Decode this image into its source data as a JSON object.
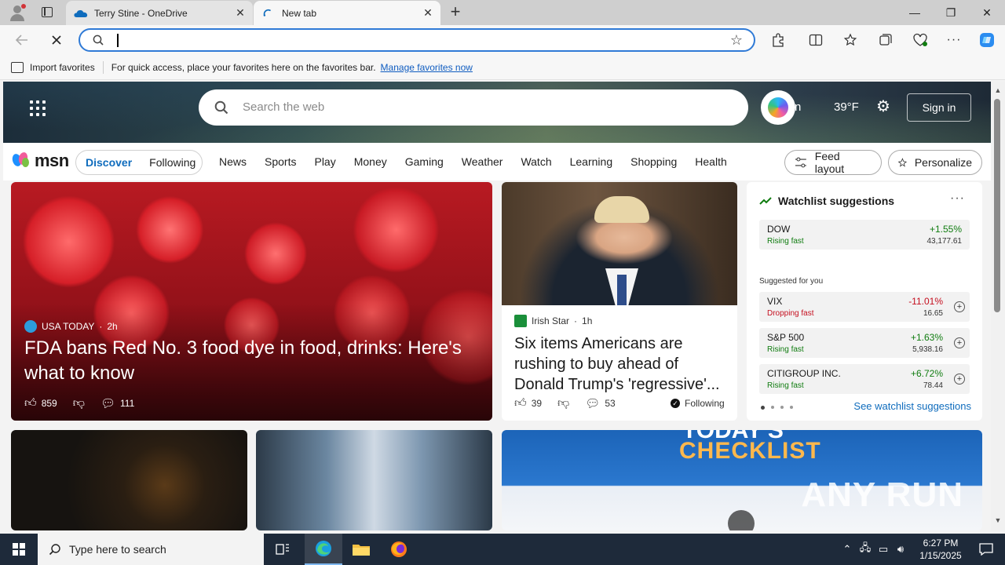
{
  "browser": {
    "tabs": [
      {
        "label": "Terry Stine - OneDrive",
        "icon": "onedrive-cloud-icon",
        "active": false
      },
      {
        "label": "New tab",
        "icon": "loading-spinner-icon",
        "active": true
      }
    ],
    "new_tab_symbol": "+",
    "close_symbol": "✕",
    "window_controls": {
      "minimize": "—",
      "maximize": "❐",
      "close": "✕"
    },
    "address": {
      "value": "",
      "placeholder": ""
    },
    "favorites_bar": {
      "import_label": "Import favorites",
      "message": "For quick access, place your favorites here on the favorites bar.",
      "link": "Manage favorites now"
    }
  },
  "msn": {
    "search_placeholder": "Search the web",
    "signin_partial": "n",
    "weather": "39°F",
    "signin_label": "Sign in",
    "logo_text": "msn",
    "segments": [
      "Discover",
      "Following"
    ],
    "nav_links": [
      "News",
      "Sports",
      "Play",
      "Money",
      "Gaming",
      "Weather",
      "Watch",
      "Learning",
      "Shopping",
      "Health"
    ],
    "feed_layout_label": "Feed layout",
    "personalize_label": "Personalize",
    "main_story": {
      "source": "USA TODAY",
      "age": "2h",
      "headline": "FDA bans Red No. 3 food dye in food, drinks: Here's what to know",
      "likes": "859",
      "comments": "111"
    },
    "second_story": {
      "source": "Irish Star",
      "age": "1h",
      "headline": "Six items Americans are rushing to buy ahead of Donald Trump's 'regressive'...",
      "likes": "39",
      "comments": "53",
      "following_label": "Following"
    },
    "watchlist": {
      "title": "Watchlist suggestions",
      "more": "···",
      "featured": {
        "name": "DOW",
        "status": "Rising fast",
        "pct": "+1.55%",
        "price": "43,177.61"
      },
      "suggested_label": "Suggested for you",
      "suggested": [
        {
          "name": "VIX",
          "status": "Dropping fast",
          "pct": "-11.01%",
          "price": "16.65",
          "trend": "down"
        },
        {
          "name": "S&P 500",
          "status": "Rising fast",
          "pct": "+1.63%",
          "price": "5,938.16",
          "trend": "up"
        },
        {
          "name": "CITIGROUP INC.",
          "status": "Rising fast",
          "pct": "+6.72%",
          "price": "78.44",
          "trend": "up"
        }
      ],
      "see_more": "See watchlist suggestions"
    },
    "checklist_card": {
      "title_top": "TODAY'S",
      "title_main": "CHECKLIST"
    },
    "watermark": "ANY RUN"
  },
  "taskbar": {
    "search_placeholder": "Type here to search",
    "time": "6:27 PM",
    "date": "1/15/2025"
  },
  "colors": {
    "accent": "#0f6cbd",
    "address_border": "#2f7ad6",
    "up": "#107c10",
    "down": "#c50f1f",
    "taskbar": "#1e2a3a"
  }
}
